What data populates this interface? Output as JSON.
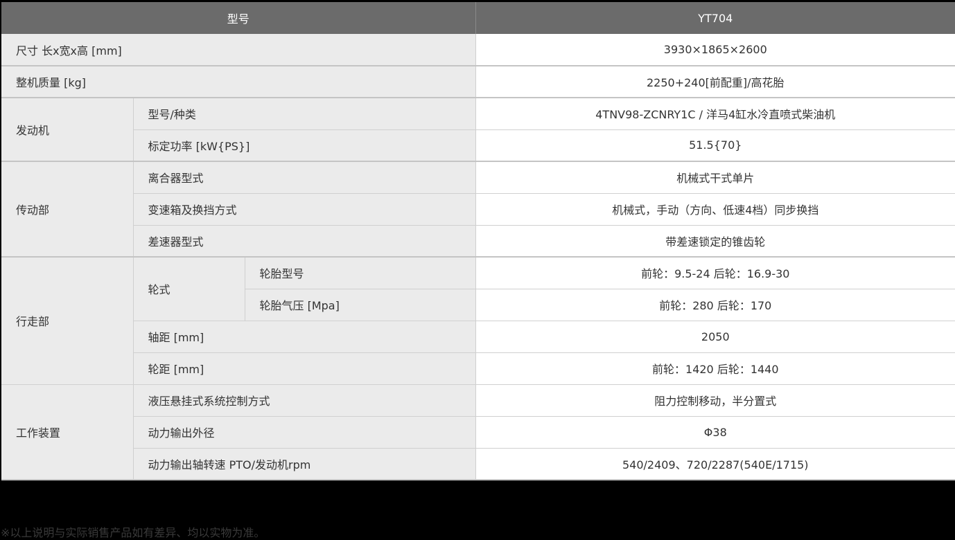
{
  "header": {
    "col_label": "型号",
    "col_value": "YT704"
  },
  "rows": {
    "size": {
      "label": "尺寸 长x宽x高 [mm]",
      "value": "3930×1865×2600"
    },
    "mass": {
      "label": "整机质量 [kg]",
      "value": "2250+240[前配重]/高花胎"
    },
    "engine": {
      "group": "发动机",
      "type": {
        "label": "型号/种类",
        "value": "4TNV98-ZCNRY1C / 洋马4缸水冷直喷式柴油机"
      },
      "power": {
        "label": "标定功率 [kW{PS}]",
        "value": "51.5{70}"
      }
    },
    "drivetrain": {
      "group": "传动部",
      "clutch": {
        "label": "离合器型式",
        "value": "机械式干式单片"
      },
      "gearbox": {
        "label": "变速箱及换挡方式",
        "value": "机械式，手动（方向、低速4档）同步换挡"
      },
      "differential": {
        "label": "差速器型式",
        "value": "带差速锁定的锥齿轮"
      }
    },
    "running": {
      "group": "行走部",
      "wheel_type": "轮式",
      "tire_model": {
        "label": "轮胎型号",
        "value": "前轮：9.5-24 后轮：16.9-30"
      },
      "tire_pressure": {
        "label": "轮胎气压 [Mpa]",
        "value": "前轮：280 后轮：170"
      },
      "wheelbase": {
        "label": "轴距 [mm]",
        "value": "2050"
      },
      "tread": {
        "label": "轮距 [mm]",
        "value": "前轮：1420 后轮：1440"
      }
    },
    "work": {
      "group": "工作装置",
      "hydraulic": {
        "label": "液压悬挂式系统控制方式",
        "value": "阻力控制移动，半分置式"
      },
      "pto_diameter": {
        "label": "动力输出外径",
        "value": "Φ38"
      },
      "pto_speed": {
        "label": "动力输出轴转速 PTO/发动机rpm",
        "value": "540/2409、720/2287(540E/1715)"
      }
    }
  },
  "footnote": "※以上说明与实际销售产品如有差异、均以实物为准。"
}
